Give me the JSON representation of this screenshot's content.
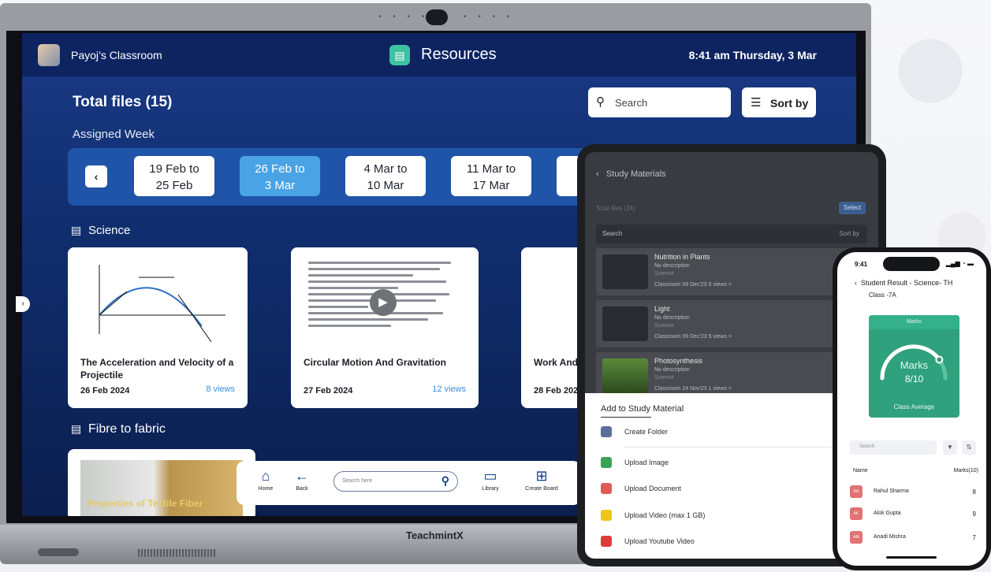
{
  "tv": {
    "class_name": "Payoj’s Classroom",
    "app_title": "Resources",
    "clock": "8:41 am  Thursday, 3 Mar",
    "brand": "TeachmintX",
    "total_files": "Total files (15)",
    "search_placeholder": "Search",
    "sort_label": "Sort by",
    "assigned_week_label": "Assigned Week",
    "weeks": [
      {
        "line1": "19 Feb to",
        "line2": "25 Feb"
      },
      {
        "line1": "26 Feb to",
        "line2": "3 Mar"
      },
      {
        "line1": "4 Mar to",
        "line2": "10 Mar"
      },
      {
        "line1": "11 Mar to",
        "line2": "17 Mar"
      }
    ],
    "active_week_index": 1,
    "sections": [
      {
        "title": "Science"
      },
      {
        "title": "Fibre to fabric"
      }
    ],
    "cards": [
      {
        "title": "The Acceleration and Velocity of a Projectile",
        "date": "26 Feb 2024",
        "views": "8 views"
      },
      {
        "title": "Circular Motion And Gravitation",
        "date": "27 Feb 2024",
        "views": "12 views"
      },
      {
        "title": "Work And",
        "date": "28 Feb 202",
        "views": ""
      }
    ],
    "fibre_card_title": "Properties of Textile Fiber",
    "dock": {
      "home": "Home",
      "back": "Back",
      "search_placeholder": "Search here",
      "library": "Library",
      "create_board": "Create Board"
    }
  },
  "tablet": {
    "header": "Study Materials",
    "subheader": "Total files (24)",
    "select_label": "Select",
    "search_label": "Search",
    "sort_label": "Sort by",
    "items": [
      {
        "title": "Nutrition in Plants",
        "desc": "No description",
        "subject": "Science",
        "meta": "Classroom  09 Dec'23  5 views >"
      },
      {
        "title": "Light",
        "desc": "No description",
        "subject": "Science",
        "meta": "Classroom  09 Dec'23  5 views >"
      },
      {
        "title": "Photosynthesis",
        "desc": "No description",
        "subject": "Science",
        "meta": "Classroom  24 Nov'23  1 views >"
      }
    ],
    "sheet_title": "Add to Study Material",
    "sheet_items": [
      {
        "label": "Create Folder",
        "color": "#5b6f9a"
      },
      {
        "label": "Upload Image",
        "color": "#3aa35a"
      },
      {
        "label": "Upload Document",
        "color": "#e15a5a"
      },
      {
        "label": "Upload Video (max 1 GB)",
        "color": "#f0c419"
      },
      {
        "label": "Upload Youtube Video",
        "color": "#e03a3a"
      }
    ]
  },
  "phone": {
    "time": "9:41",
    "title": "Student Result - Science- TH",
    "class": "Class -7A",
    "marks_header": "Marks",
    "marks_label": "Marks",
    "marks_value": "8/10",
    "marks_fraction": 0.8,
    "class_average": "Class Average",
    "search_placeholder": "Search",
    "col_name": "Name",
    "col_marks": "Marks(10)",
    "students": [
      {
        "initials": "AA",
        "name": "Rahul Sharma",
        "marks": "8"
      },
      {
        "initials": "AK",
        "name": "Alok Gupta",
        "marks": "9"
      },
      {
        "initials": "AM",
        "name": "Anadi Mishra",
        "marks": "7"
      }
    ]
  }
}
